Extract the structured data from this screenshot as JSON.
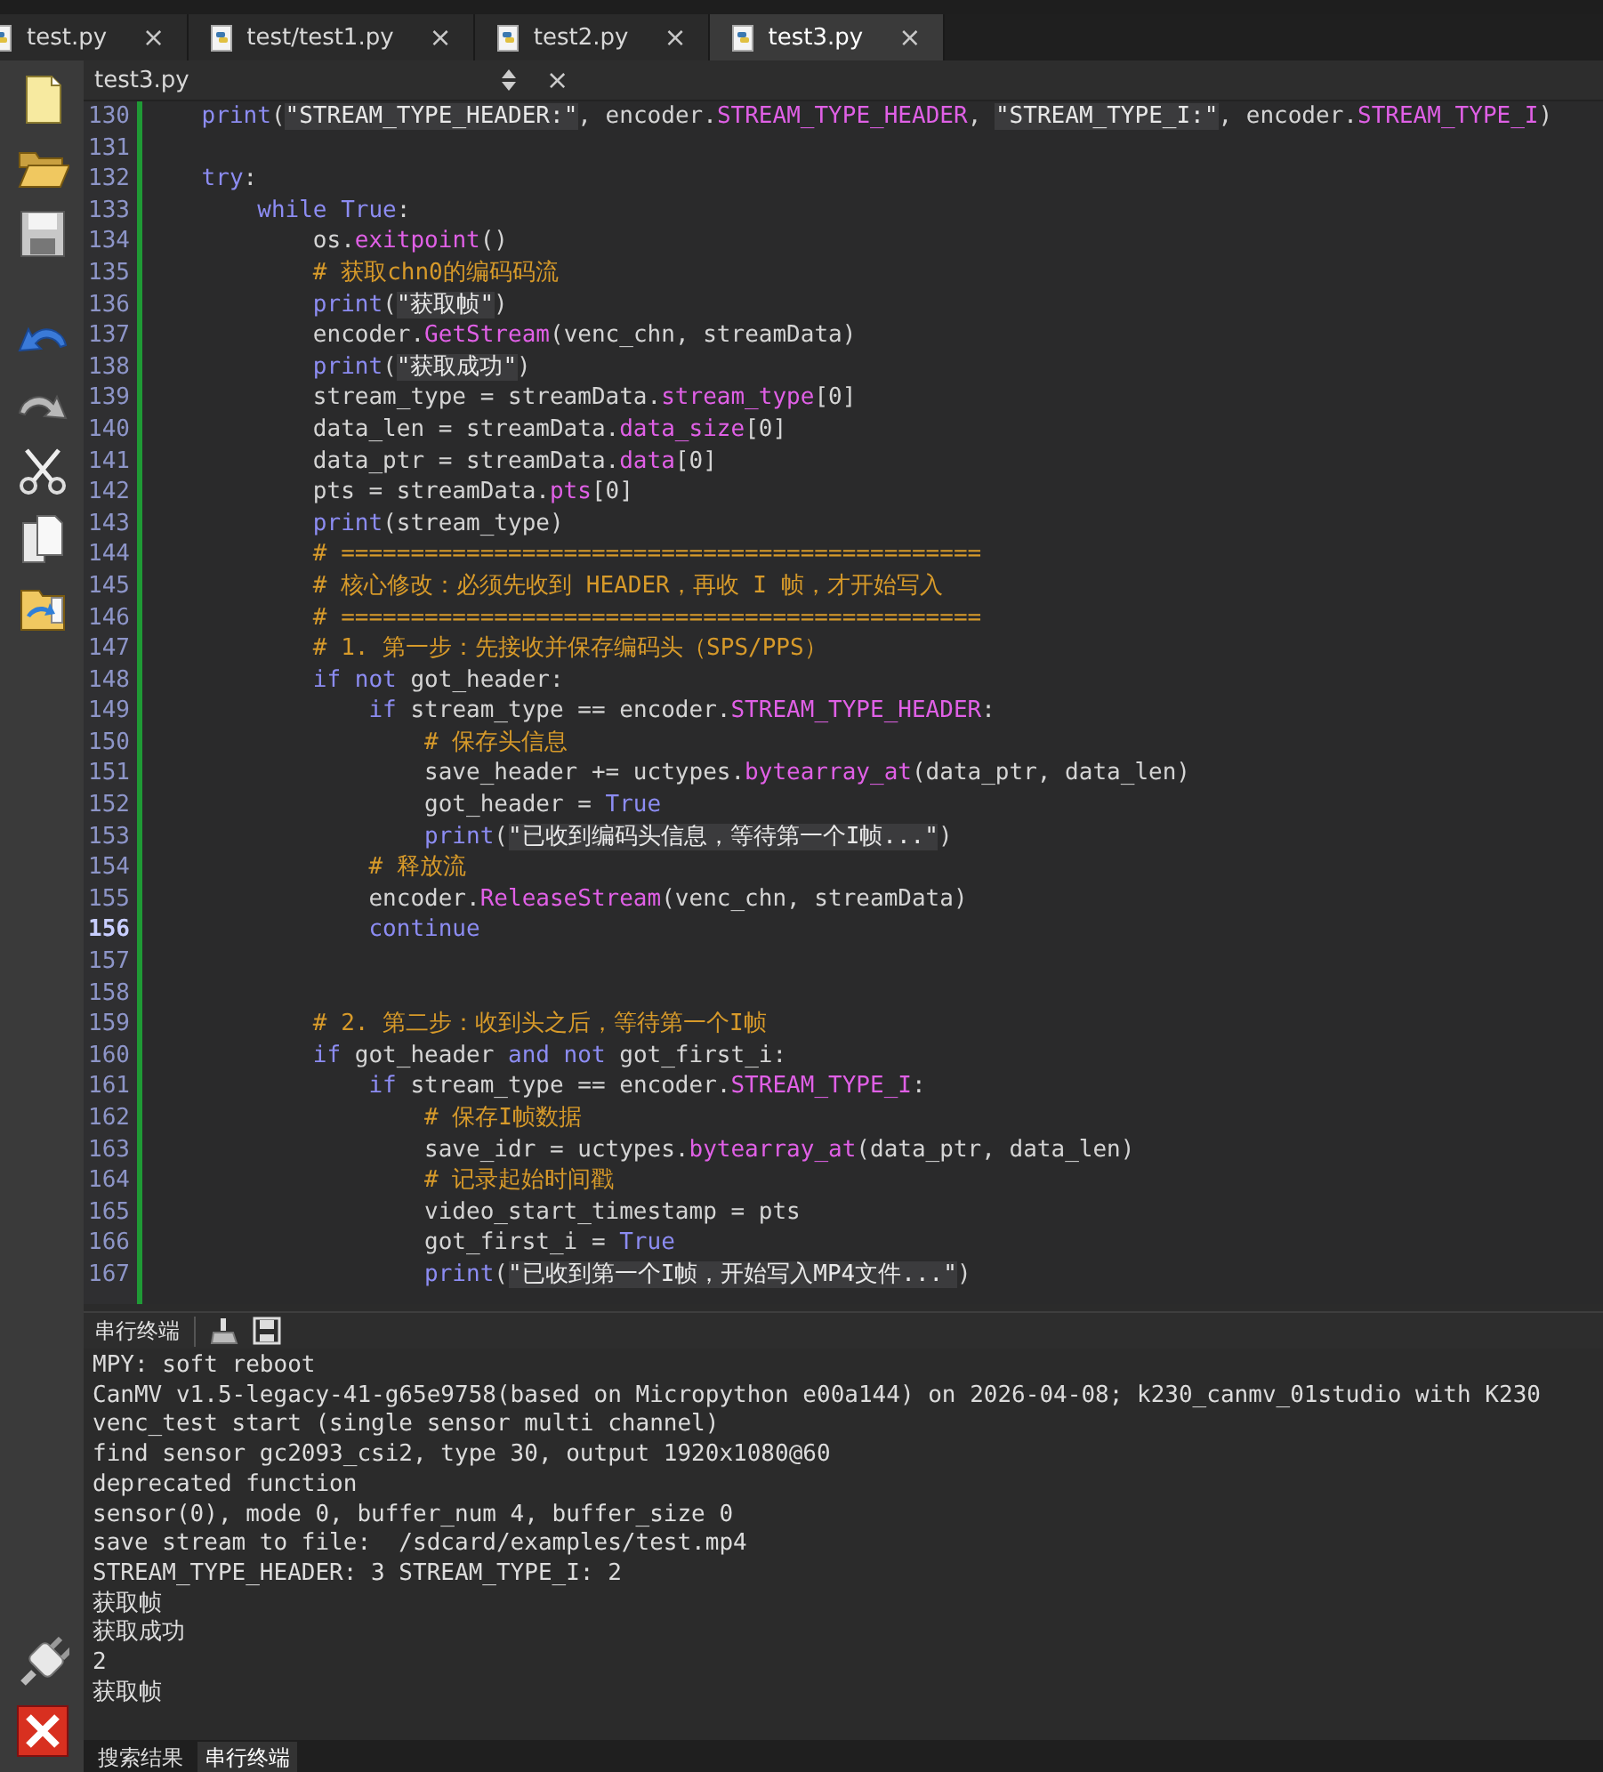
{
  "tabs": [
    {
      "label": "test.py",
      "close": "×",
      "selected": false
    },
    {
      "label": "test/test1.py",
      "close": "×",
      "selected": false
    },
    {
      "label": "test2.py",
      "close": "×",
      "selected": false
    },
    {
      "label": "test3.py",
      "close": "×",
      "selected": true
    }
  ],
  "editor": {
    "file_selector": "test3.py",
    "close": "×",
    "lines": [
      {
        "number": "130",
        "current": false,
        "tokens": [
          {
            "kind": "kw",
            "text": "    print"
          },
          {
            "kind": "plain",
            "text": "("
          },
          {
            "kind": "str",
            "text": "\"STREAM_TYPE_HEADER:\""
          },
          {
            "kind": "plain",
            "text": ", encoder."
          },
          {
            "kind": "attr",
            "text": "STREAM_TYPE_HEADER"
          },
          {
            "kind": "plain",
            "text": ", "
          },
          {
            "kind": "str",
            "text": "\"STREAM_TYPE_I:\""
          },
          {
            "kind": "plain",
            "text": ", encoder."
          },
          {
            "kind": "attr",
            "text": "STREAM_TYPE_I"
          },
          {
            "kind": "plain",
            "text": ")"
          }
        ]
      },
      {
        "number": "131",
        "current": false
      },
      {
        "number": "132",
        "current": false,
        "tokens": [
          {
            "kind": "kw",
            "text": "    try"
          },
          {
            "kind": "plain",
            "text": ":"
          }
        ]
      },
      {
        "number": "133",
        "current": false,
        "tokens": [
          {
            "kind": "kw",
            "text": "        while True"
          },
          {
            "kind": "plain",
            "text": ":"
          }
        ]
      },
      {
        "number": "134",
        "current": false,
        "tokens": [
          {
            "kind": "plain",
            "text": "            os."
          },
          {
            "kind": "attr",
            "text": "exitpoint"
          },
          {
            "kind": "plain",
            "text": "()"
          }
        ]
      },
      {
        "number": "135",
        "current": false,
        "tokens": [
          {
            "kind": "com",
            "text": "            # 获取chn0的编码码流"
          }
        ]
      },
      {
        "number": "136",
        "current": false,
        "tokens": [
          {
            "kind": "kw",
            "text": "            print"
          },
          {
            "kind": "plain",
            "text": "("
          },
          {
            "kind": "str",
            "text": "\"获取帧\""
          },
          {
            "kind": "plain",
            "text": ")"
          }
        ]
      },
      {
        "number": "137",
        "current": false,
        "tokens": [
          {
            "kind": "plain",
            "text": "            encoder."
          },
          {
            "kind": "attr",
            "text": "GetStream"
          },
          {
            "kind": "plain",
            "text": "(venc_chn, streamData)"
          }
        ]
      },
      {
        "number": "138",
        "current": false,
        "tokens": [
          {
            "kind": "kw",
            "text": "            print"
          },
          {
            "kind": "plain",
            "text": "("
          },
          {
            "kind": "str",
            "text": "\"获取成功\""
          },
          {
            "kind": "plain",
            "text": ")"
          }
        ]
      },
      {
        "number": "139",
        "current": false,
        "tokens": [
          {
            "kind": "plain",
            "text": "            stream_type = streamData."
          },
          {
            "kind": "attr",
            "text": "stream_type"
          },
          {
            "kind": "plain",
            "text": "[0]"
          }
        ]
      },
      {
        "number": "140",
        "current": false,
        "tokens": [
          {
            "kind": "plain",
            "text": "            data_len = streamData."
          },
          {
            "kind": "attr",
            "text": "data_size"
          },
          {
            "kind": "plain",
            "text": "[0]"
          }
        ]
      },
      {
        "number": "141",
        "current": false,
        "tokens": [
          {
            "kind": "plain",
            "text": "            data_ptr = streamData."
          },
          {
            "kind": "attr",
            "text": "data"
          },
          {
            "kind": "plain",
            "text": "[0]"
          }
        ]
      },
      {
        "number": "142",
        "current": false,
        "tokens": [
          {
            "kind": "plain",
            "text": "            pts = streamData."
          },
          {
            "kind": "attr",
            "text": "pts"
          },
          {
            "kind": "plain",
            "text": "[0]"
          }
        ]
      },
      {
        "number": "143",
        "current": false,
        "tokens": [
          {
            "kind": "kw",
            "text": "            print"
          },
          {
            "kind": "plain",
            "text": "(stream_type)"
          }
        ]
      },
      {
        "number": "144",
        "current": false,
        "tokens": [
          {
            "kind": "com",
            "text": "            # =============================================="
          }
        ]
      },
      {
        "number": "145",
        "current": false,
        "tokens": [
          {
            "kind": "com",
            "text": "            # 核心修改：必须先收到 HEADER，再收 I 帧，才开始写入"
          }
        ]
      },
      {
        "number": "146",
        "current": false,
        "tokens": [
          {
            "kind": "com",
            "text": "            # =============================================="
          }
        ]
      },
      {
        "number": "147",
        "current": false,
        "tokens": [
          {
            "kind": "com",
            "text": "            # 1. 第一步：先接收并保存编码头（SPS/PPS）"
          }
        ]
      },
      {
        "number": "148",
        "current": false,
        "tokens": [
          {
            "kind": "kw",
            "text": "            if not"
          },
          {
            "kind": "plain",
            "text": " got_header:"
          }
        ]
      },
      {
        "number": "149",
        "current": false,
        "tokens": [
          {
            "kind": "kw",
            "text": "                if"
          },
          {
            "kind": "plain",
            "text": " stream_type == encoder."
          },
          {
            "kind": "attr",
            "text": "STREAM_TYPE_HEADER"
          },
          {
            "kind": "plain",
            "text": ":"
          }
        ]
      },
      {
        "number": "150",
        "current": false,
        "tokens": [
          {
            "kind": "com",
            "text": "                    # 保存头信息"
          }
        ]
      },
      {
        "number": "151",
        "current": false,
        "tokens": [
          {
            "kind": "plain",
            "text": "                    save_header += uctypes."
          },
          {
            "kind": "attr",
            "text": "bytearray_at"
          },
          {
            "kind": "plain",
            "text": "(data_ptr, data_len)"
          }
        ]
      },
      {
        "number": "152",
        "current": false,
        "tokens": [
          {
            "kind": "plain",
            "text": "                    got_header = "
          },
          {
            "kind": "kw",
            "text": "True"
          }
        ]
      },
      {
        "number": "153",
        "current": false,
        "tokens": [
          {
            "kind": "kw",
            "text": "                    print"
          },
          {
            "kind": "plain",
            "text": "("
          },
          {
            "kind": "str",
            "text": "\"已收到编码头信息，等待第一个I帧...\""
          },
          {
            "kind": "plain",
            "text": ")"
          }
        ]
      },
      {
        "number": "154",
        "current": false,
        "tokens": [
          {
            "kind": "com",
            "text": "                # 释放流"
          }
        ]
      },
      {
        "number": "155",
        "current": false,
        "tokens": [
          {
            "kind": "plain",
            "text": "                encoder."
          },
          {
            "kind": "attr",
            "text": "ReleaseStream"
          },
          {
            "kind": "plain",
            "text": "(venc_chn, streamData)"
          }
        ]
      },
      {
        "number": "156",
        "current": true,
        "tokens": [
          {
            "kind": "kw",
            "text": "                continue"
          }
        ]
      },
      {
        "number": "157",
        "current": false
      },
      {
        "number": "158",
        "current": false
      },
      {
        "number": "159",
        "current": false,
        "tokens": [
          {
            "kind": "com",
            "text": "            # 2. 第二步：收到头之后，等待第一个I帧"
          }
        ]
      },
      {
        "number": "160",
        "current": false,
        "tokens": [
          {
            "kind": "kw",
            "text": "            if"
          },
          {
            "kind": "plain",
            "text": " got_header "
          },
          {
            "kind": "kw",
            "text": "and not"
          },
          {
            "kind": "plain",
            "text": " got_first_i:"
          }
        ]
      },
      {
        "number": "161",
        "current": false,
        "tokens": [
          {
            "kind": "kw",
            "text": "                if"
          },
          {
            "kind": "plain",
            "text": " stream_type == encoder."
          },
          {
            "kind": "attr",
            "text": "STREAM_TYPE_I"
          },
          {
            "kind": "plain",
            "text": ":"
          }
        ]
      },
      {
        "number": "162",
        "current": false,
        "tokens": [
          {
            "kind": "com",
            "text": "                    # 保存I帧数据"
          }
        ]
      },
      {
        "number": "163",
        "current": false,
        "tokens": [
          {
            "kind": "plain",
            "text": "                    save_idr = uctypes."
          },
          {
            "kind": "attr",
            "text": "bytearray_at"
          },
          {
            "kind": "plain",
            "text": "(data_ptr, data_len)"
          }
        ]
      },
      {
        "number": "164",
        "current": false,
        "tokens": [
          {
            "kind": "com",
            "text": "                    # 记录起始时间戳"
          }
        ]
      },
      {
        "number": "165",
        "current": false,
        "tokens": [
          {
            "kind": "plain",
            "text": "                    video_start_timestamp = pts"
          }
        ]
      },
      {
        "number": "166",
        "current": false,
        "tokens": [
          {
            "kind": "plain",
            "text": "                    got_first_i = "
          },
          {
            "kind": "kw",
            "text": "True"
          }
        ]
      },
      {
        "number": "167",
        "current": false,
        "tokens": [
          {
            "kind": "kw",
            "text": "                    print"
          },
          {
            "kind": "plain",
            "text": "("
          },
          {
            "kind": "str",
            "text": "\"已收到第一个I帧，开始写入MP4文件...\""
          },
          {
            "kind": "plain",
            "text": ")"
          }
        ]
      }
    ]
  },
  "terminal": {
    "title": "串行终端",
    "lines": [
      "MPY: soft reboot",
      "CanMV v1.5-legacy-41-g65e9758(based on Micropython e00a144) on 2026-04-08; k230_canmv_01studio with K230",
      "venc_test start (single sensor multi channel)",
      "find sensor gc2093_csi2, type 30, output 1920x1080@60",
      "deprecated function",
      "sensor(0), mode 0, buffer_num 4, buffer_size 0",
      "save stream to file:  /sdcard/examples/test.mp4",
      "STREAM_TYPE_HEADER: 3 STREAM_TYPE_I: 2",
      "获取帧",
      "获取成功",
      "2",
      "获取帧"
    ]
  },
  "bottom_tabs": [
    {
      "label": "搜索结果",
      "selected": false
    },
    {
      "label": "串行终端",
      "selected": true
    }
  ]
}
